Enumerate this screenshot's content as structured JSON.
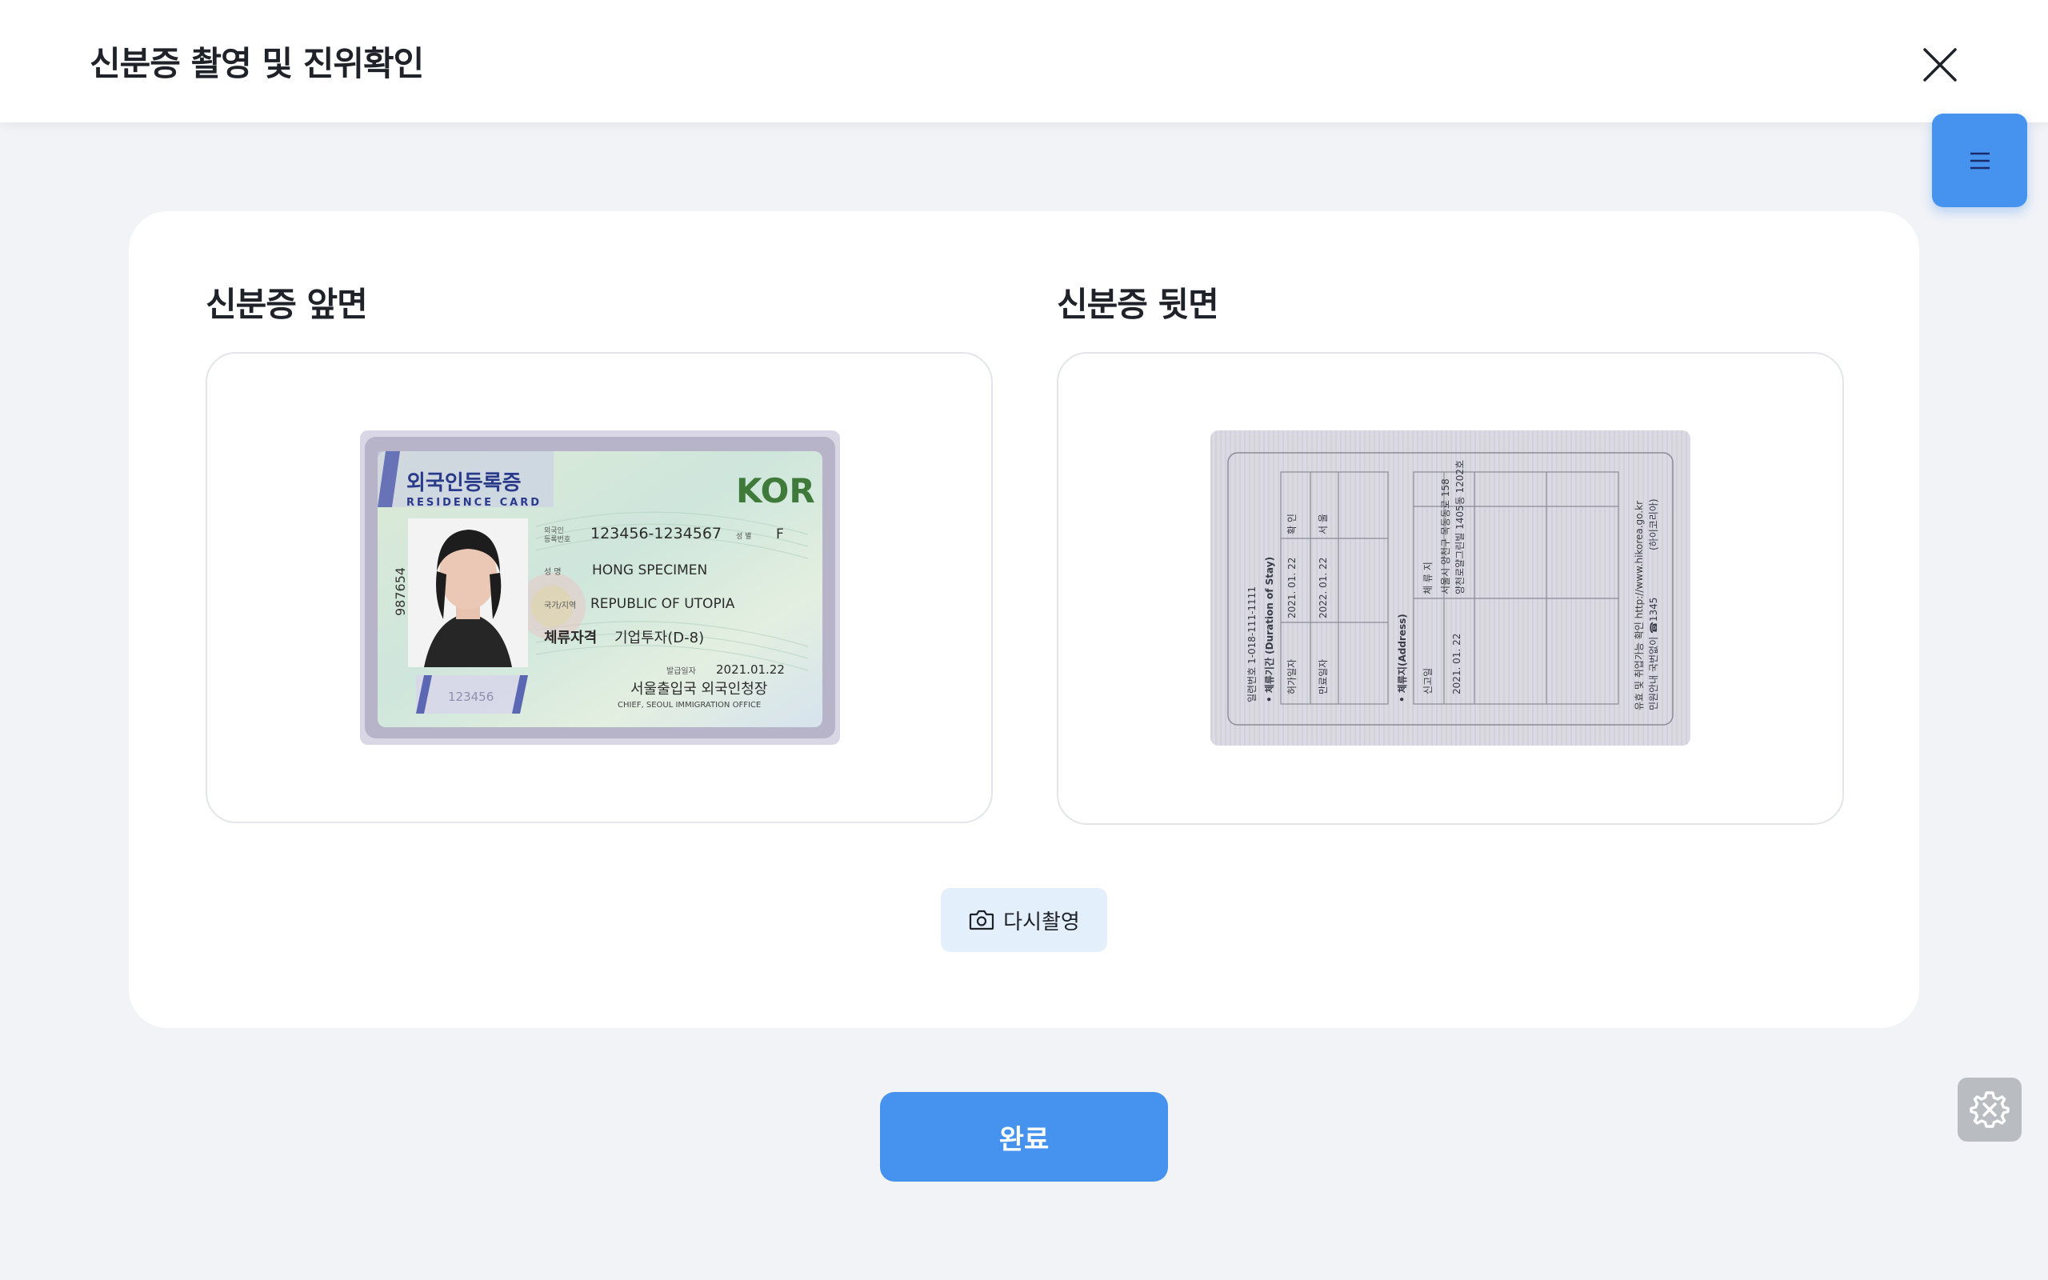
{
  "header": {
    "title": "신분증 촬영 및 진위확인"
  },
  "icons": {
    "close": "close-icon",
    "menu": "hamburger-icon",
    "camera": "camera-icon",
    "settings": "gear-icon"
  },
  "colors": {
    "primary": "#4593ee",
    "light_button": "#e4effc",
    "background": "#f1f3f7"
  },
  "panels": {
    "front": {
      "title": "신분증 앞면",
      "card": {
        "title_ko": "외국인등록증",
        "title_en": "RESIDENCE CARD",
        "country": "KOR",
        "number": "123456-1234567",
        "sex_label": "성 별",
        "sex": "F",
        "name": "HONG SPECIMEN",
        "nationality": "REPUBLIC OF UTOPIA",
        "status_label": "체류자격",
        "status": "기업투자(D-8)",
        "issue_label": "발급일자",
        "issue_date": "2021.01.22",
        "issuer_ko": "서울출입국 외국인청장",
        "issuer_en": "CHIEF, SEOUL IMMIGRATION OFFICE",
        "side_number": "987654",
        "hologram_number": "123456"
      }
    },
    "back": {
      "title": "신분증 뒷면",
      "card": {
        "serial": "일련번호 1-018-111-1111",
        "stay_title": "• 체류기간 (Duration of Stay)",
        "permit_label": "허가일자",
        "permit_date": "2021. 01. 22",
        "expiry_label": "만료일자",
        "expiry_date": "2022. 01. 22",
        "confirm_label": "확 인",
        "confirm_value": "서 울",
        "address_title": "• 체류지(Address)",
        "report_label": "신고일",
        "report_date": "2021. 01. 22",
        "address_label": "체 류 지",
        "address_line1": "서울시 양천구 목동동로 158",
        "address_line2": "양천로얄그린빌 1405동 1202호",
        "website": "유효 및 취업가능 확인 http://www.hikorea.go.kr",
        "guide": "민원안내 국번없이 ☎1345",
        "guide2": "(하이코리아)"
      }
    }
  },
  "buttons": {
    "retake": "다시촬영",
    "done": "완료"
  }
}
